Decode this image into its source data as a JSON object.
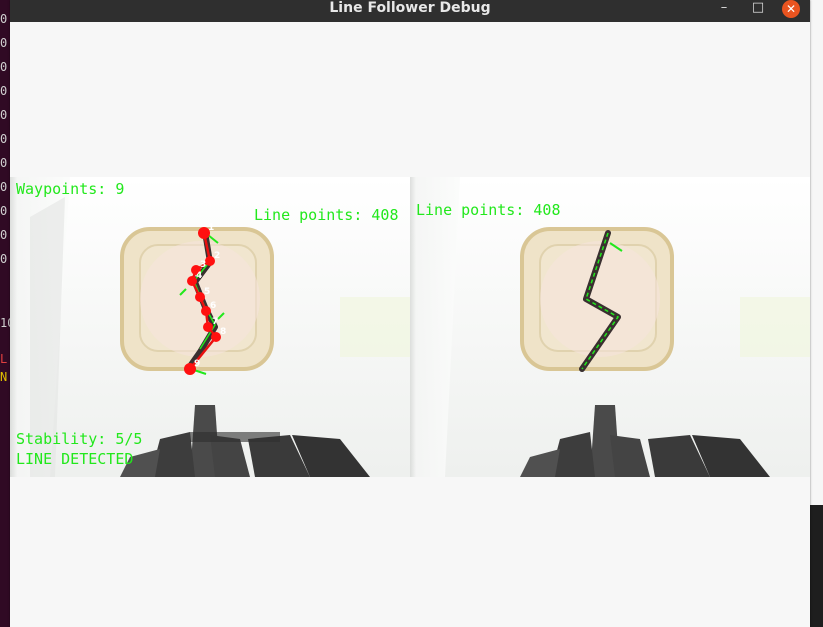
{
  "window": {
    "title": "Line Follower Debug",
    "minimize_glyph": "–",
    "maximize_glyph": "□",
    "close_glyph": "✕"
  },
  "terminal_fragments": [
    "0",
    "0",
    "0",
    "0",
    "0",
    "0",
    "0",
    "0",
    "0",
    "0",
    "0",
    "10",
    "L",
    "N"
  ],
  "left_view": {
    "waypoints_text": "Waypoints: 9",
    "line_points_text": "Line points: 408",
    "stability_text": "Stability: 5/5",
    "status_text": "LINE DETECTED",
    "waypoint_labels": [
      "1",
      "2",
      "3",
      "4",
      "5",
      "6",
      "7",
      "8",
      "9"
    ]
  },
  "right_view": {
    "line_points_text": "Line points: 408"
  },
  "colors": {
    "overlay_text": "#22e81c",
    "waypoint": "#ff1010",
    "path": "#e81010",
    "titlebar": "#2f2f2f",
    "close_button": "#e95420"
  }
}
